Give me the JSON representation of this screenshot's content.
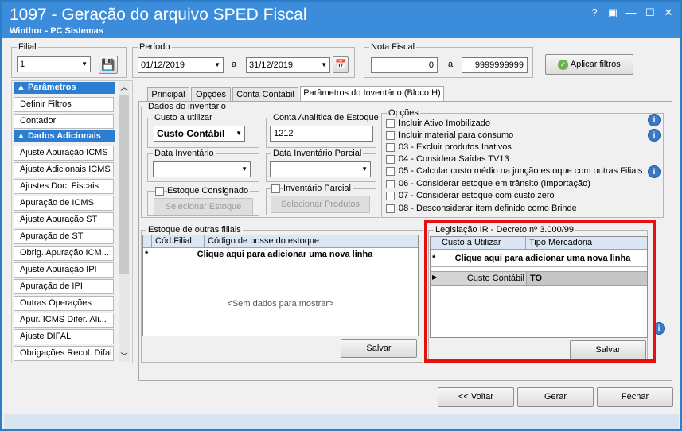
{
  "window": {
    "title": "1097 - Geração do arquivo SPED Fiscal",
    "subtitle": "Winthor - PC Sistemas",
    "controls": [
      "?",
      "▣",
      "—",
      "☐",
      "✕"
    ]
  },
  "filters": {
    "filial_label": "Filial",
    "filial_value": "1",
    "periodo_label": "Período",
    "date_from": "01/12/2019",
    "date_sep": "a",
    "date_to": "31/12/2019",
    "nota_label": "Nota Fiscal",
    "nota_from": "0",
    "nota_sep": "a",
    "nota_to": "9999999999",
    "apply_label": "Aplicar filtros"
  },
  "sidebar": {
    "section1": "Parâmetros",
    "section1_items": [
      "Definir Filtros",
      "Contador"
    ],
    "section2": "Dados Adicionais",
    "section2_items": [
      "Ajuste Apuração ICMS",
      "Ajuste Adicionais ICMS",
      "Ajustes Doc. Fiscais",
      "Apuração de ICMS",
      "Ajuste Apuração ST",
      "Apuração de ST",
      "Obrig. Apuração ICM...",
      "Ajuste Apuração IPI",
      "Apuração de IPI",
      "Outras Operações",
      "Apur. ICMS Difer. Ali...",
      "Ajuste DIFAL",
      "Obrigações Recol. Difal"
    ]
  },
  "tabs": [
    "Principal",
    "Opções",
    "Conta Contábil",
    "Parâmetros do Inventário (Bloco H)"
  ],
  "inventario": {
    "group_label": "Dados do inventário",
    "custo_label": "Custo a utilizar",
    "custo_value": "Custo Contábil",
    "conta_label": "Conta Analítica de Estoque",
    "conta_value": "1212",
    "data_label": "Data Inventário",
    "data_parcial_label": "Data Inventário Parcial",
    "consignado_label": "Estoque Consignado",
    "consignado_btn": "Selecionar Estoque",
    "parcial_label": "Inventário Parcial",
    "parcial_btn": "Selecionar Produtos"
  },
  "opcoes": {
    "label": "Opções",
    "items": [
      "Incluir Ativo Imobilizado",
      "Incluir material para consumo",
      "03 - Excluir produtos Inativos",
      "04 - Considera Saídas TV13",
      "05 - Calcular custo médio na junção estoque com outras Filiais",
      "06 - Considerar estoque em trânsito (Importação)",
      "07 - Considerar estoque com custo zero",
      "08 - Desconsiderar ítem definido como Brinde"
    ]
  },
  "estoque_filiais": {
    "label": "Estoque de outras filiais",
    "col1": "Cód.Filial",
    "col2": "Código de posse do estoque",
    "new_row": "Clique aqui para adicionar uma nova linha",
    "empty": "<Sem dados para mostrar>",
    "save": "Salvar"
  },
  "legislacao": {
    "label": "Legislação IR - Decreto nº 3.000/99",
    "col1": "Custo a Utilizar",
    "col2": "Tipo Mercadoria",
    "new_row": "Clique aqui para adicionar uma nova linha",
    "row_custo": "Custo Contábil",
    "row_tipo": "TO",
    "save": "Salvar"
  },
  "footer": {
    "voltar": "<< Voltar",
    "gerar": "Gerar",
    "fechar": "Fechar"
  },
  "colors": {
    "titlebar": "#3b8ddc",
    "accent": "#2c7fd0",
    "highlight": "#e61010"
  }
}
